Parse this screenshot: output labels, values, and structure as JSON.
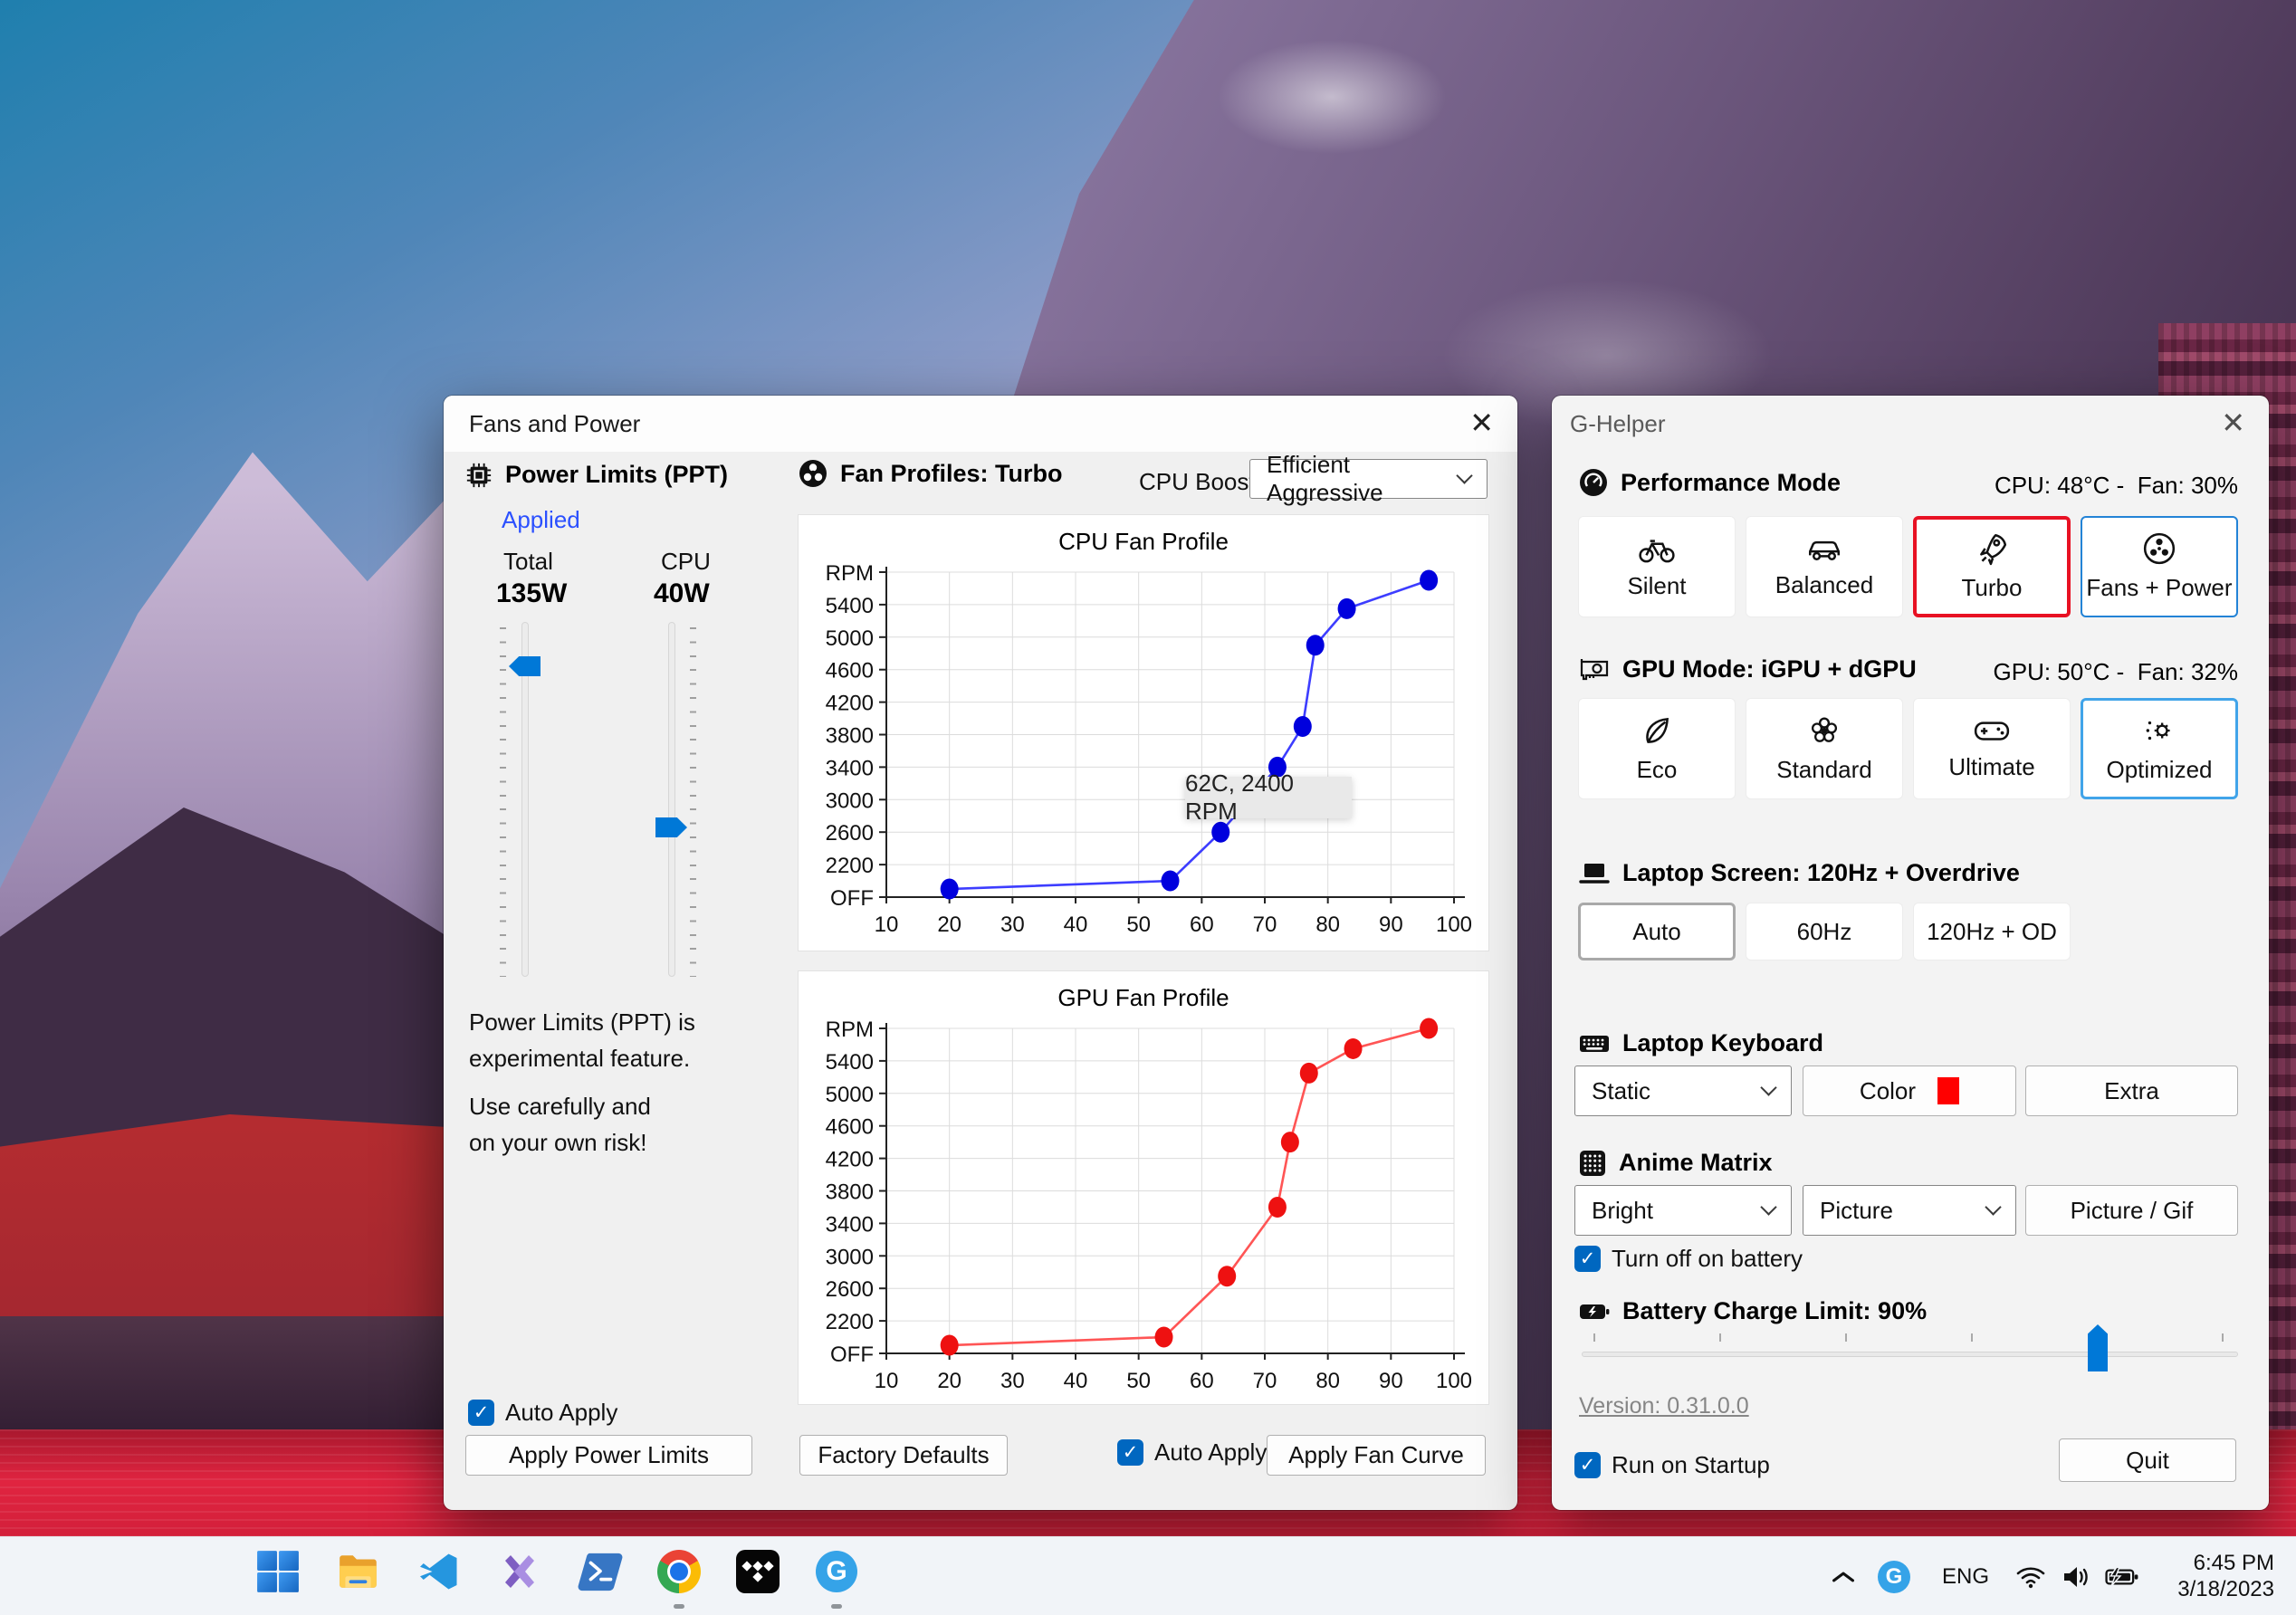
{
  "taskbar": {
    "icons": [
      "start",
      "file-explorer",
      "vscode",
      "visual-studio",
      "powershell",
      "chrome",
      "tidal",
      "g-helper"
    ],
    "running_indicators": [
      "chrome",
      "g-helper"
    ],
    "tray": {
      "language": "ENG",
      "time": "6:45 PM",
      "date": "3/18/2023"
    }
  },
  "fans_window": {
    "title": "Fans and Power",
    "close_glyph": "✕",
    "power_limits": {
      "header": "Power Limits (PPT)",
      "status": "Applied",
      "total_label": "Total",
      "total_value": "135W",
      "cpu_label": "CPU",
      "cpu_value": "40W",
      "note_line1": "Power Limits (PPT) is",
      "note_line2": "experimental feature.",
      "note_line3": "Use carefully and",
      "note_line4": "on your own risk!",
      "auto_apply_label": "Auto Apply",
      "apply_button": "Apply Power Limits"
    },
    "fan_profiles": {
      "header": "Fan Profiles: Turbo",
      "cpu_boost_label": "CPU Boost",
      "cpu_boost_value": "Efficient Aggressive",
      "factory_defaults_button": "Factory Defaults",
      "auto_apply_label": "Auto Apply",
      "apply_fan_curve_button": "Apply Fan Curve"
    }
  },
  "chart_data": [
    {
      "type": "line",
      "title": "CPU Fan Profile",
      "series": [
        {
          "name": "CPU fan curve",
          "x": [
            20,
            55,
            63,
            72,
            76,
            78,
            83,
            96
          ],
          "y": [
            1900,
            2000,
            2600,
            3400,
            3900,
            4900,
            5350,
            5700
          ]
        }
      ],
      "point_color": "#0000dd",
      "line_color": "#3d3dff",
      "xlabel": "",
      "ylabel_top": "RPM",
      "ylabel_bottom": "OFF",
      "xticks": [
        10,
        20,
        30,
        40,
        50,
        60,
        70,
        80,
        90,
        100
      ],
      "yticks": [
        2200,
        2600,
        3000,
        3400,
        3800,
        4200,
        4600,
        5000,
        5400
      ],
      "xlim": [
        10,
        100
      ],
      "ylim": [
        1800,
        5800
      ],
      "grid": true,
      "legend": null,
      "annotation": "62C, 2400 RPM"
    },
    {
      "type": "line",
      "title": "GPU Fan Profile",
      "series": [
        {
          "name": "GPU fan curve",
          "x": [
            20,
            54,
            64,
            72,
            74,
            77,
            84,
            96
          ],
          "y": [
            1900,
            2000,
            2750,
            3600,
            4400,
            5250,
            5550,
            5800
          ]
        }
      ],
      "point_color": "#ee1111",
      "line_color": "#ff5555",
      "xlabel": "",
      "ylabel_top": "RPM",
      "ylabel_bottom": "OFF",
      "xticks": [
        10,
        20,
        30,
        40,
        50,
        60,
        70,
        80,
        90,
        100
      ],
      "yticks": [
        2200,
        2600,
        3000,
        3400,
        3800,
        4200,
        4600,
        5000,
        5400
      ],
      "xlim": [
        10,
        100
      ],
      "ylim": [
        1800,
        5800
      ],
      "grid": true,
      "legend": null,
      "annotation": null
    }
  ],
  "ghelper_window": {
    "title": "G-Helper",
    "close_glyph": "✕",
    "performance": {
      "header": "Performance Mode",
      "status": "CPU: 48°C -  Fan: 30%",
      "buttons": [
        "Silent",
        "Balanced",
        "Turbo",
        "Fans + Power"
      ],
      "selected": "Turbo"
    },
    "gpu": {
      "header": "GPU Mode: iGPU + dGPU",
      "status": "GPU: 50°C -  Fan: 32%",
      "buttons": [
        "Eco",
        "Standard",
        "Ultimate",
        "Optimized"
      ],
      "selected": "Optimized"
    },
    "screen": {
      "header": "Laptop Screen: 120Hz + Overdrive",
      "buttons": [
        "Auto",
        "60Hz",
        "120Hz + OD"
      ],
      "selected": "Auto"
    },
    "keyboard": {
      "header": "Laptop Keyboard",
      "mode_value": "Static",
      "color_button": "Color",
      "color_swatch": "#ff0000",
      "extra_button": "Extra"
    },
    "matrix": {
      "header": "Anime Matrix",
      "brightness_value": "Bright",
      "content_value": "Picture",
      "picture_button": "Picture / Gif",
      "battery_checkbox_label": "Turn off on battery"
    },
    "battery": {
      "header": "Battery Charge Limit: 90%"
    },
    "version_link": "Version: 0.31.0.0",
    "startup_checkbox_label": "Run on Startup",
    "quit_button": "Quit"
  },
  "colors": {
    "checkbox_blue": "#0067c0",
    "slider_blue": "#0078d7",
    "selected_red_border": "#e81123",
    "selected_blue_border": "#2383d6",
    "selected_lightblue_border": "#41a4e9",
    "applied_link_blue": "#2b50ff"
  }
}
